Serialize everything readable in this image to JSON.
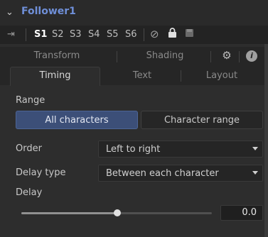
{
  "header": {
    "collapse_glyph": "⌄",
    "title": "Follower1"
  },
  "versions": {
    "pin_icon": "pin-icon",
    "slots": [
      "S1",
      "S2",
      "S3",
      "S4",
      "S5",
      "S6"
    ],
    "active": "S1",
    "icons": [
      "disable-icon",
      "lock-icon",
      "save-icon"
    ]
  },
  "tabs": {
    "row1": [
      "Transform",
      "Shading"
    ],
    "row1_icons": [
      "gear-icon",
      "info-icon"
    ],
    "row2": [
      "Timing",
      "Text",
      "Layout"
    ],
    "selected": "Timing"
  },
  "range": {
    "label": "Range",
    "options": [
      "All characters",
      "Character range"
    ],
    "selected": "All characters"
  },
  "order": {
    "label": "Order",
    "value": "Left to right"
  },
  "delay_type": {
    "label": "Delay type",
    "value": "Between each character"
  },
  "delay": {
    "label": "Delay",
    "value": "0.0"
  },
  "colors": {
    "accent": "#3c4f78",
    "title": "#6f8fd8"
  }
}
